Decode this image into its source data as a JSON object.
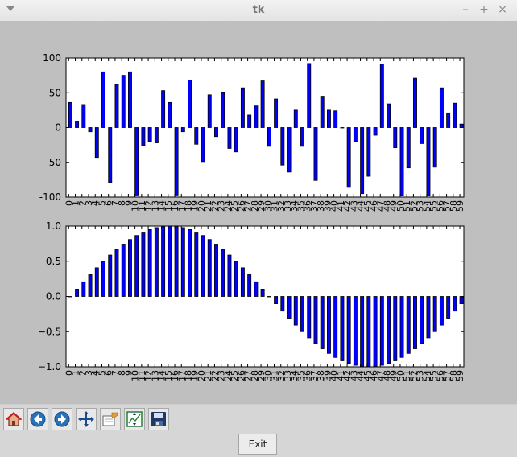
{
  "window": {
    "title": "tk"
  },
  "window_controls": {
    "minimize": "–",
    "maximize": "+",
    "close": "×"
  },
  "toolbar": {
    "tools": [
      {
        "name": "home",
        "icon": "home-icon"
      },
      {
        "name": "back",
        "icon": "back-arrow-icon"
      },
      {
        "name": "forward",
        "icon": "forward-arrow-icon"
      },
      {
        "name": "pan",
        "icon": "pan-move-icon"
      },
      {
        "name": "zoom",
        "icon": "zoom-rect-icon"
      },
      {
        "name": "configure",
        "icon": "subplots-config-icon"
      },
      {
        "name": "save",
        "icon": "save-disk-icon"
      }
    ],
    "exit_label": "Exit"
  },
  "chart_data": [
    {
      "type": "bar",
      "categories": [
        "0",
        "1",
        "2",
        "3",
        "4",
        "5",
        "6",
        "7",
        "8",
        "9",
        "10",
        "11",
        "12",
        "13",
        "14",
        "15",
        "16",
        "17",
        "18",
        "19",
        "20",
        "21",
        "22",
        "23",
        "24",
        "25",
        "26",
        "27",
        "28",
        "29",
        "30",
        "31",
        "32",
        "33",
        "34",
        "35",
        "36",
        "37",
        "38",
        "39",
        "40",
        "41",
        "42",
        "43",
        "44",
        "45",
        "46",
        "47",
        "48",
        "49",
        "50",
        "51",
        "52",
        "53",
        "54",
        "55",
        "56",
        "57",
        "58",
        "59"
      ],
      "values": [
        36,
        9,
        33,
        -6,
        -43,
        80,
        -79,
        62,
        75,
        80,
        -97,
        -26,
        -20,
        -22,
        53,
        36,
        -97,
        -6,
        68,
        -24,
        -49,
        47,
        -13,
        51,
        -30,
        -35,
        57,
        18,
        31,
        67,
        -27,
        41,
        -54,
        -64,
        25,
        -27,
        92,
        -76,
        45,
        25,
        24,
        0,
        -86,
        -20,
        -95,
        -70,
        -11,
        91,
        34,
        -29,
        -98,
        -58,
        71,
        -23,
        -98,
        -57,
        57,
        21,
        35,
        5
      ],
      "ylim": [
        -100,
        100
      ],
      "yticks": [
        -100,
        -50,
        0,
        50,
        100
      ],
      "bar_color": "#0000ff",
      "edge_color": "#000000"
    },
    {
      "type": "bar",
      "categories": [
        "0",
        "1",
        "2",
        "3",
        "4",
        "5",
        "6",
        "7",
        "8",
        "9",
        "10",
        "11",
        "12",
        "13",
        "14",
        "15",
        "16",
        "17",
        "18",
        "19",
        "20",
        "21",
        "22",
        "23",
        "24",
        "25",
        "26",
        "27",
        "28",
        "29",
        "30",
        "31",
        "32",
        "33",
        "34",
        "35",
        "36",
        "37",
        "38",
        "39",
        "40",
        "41",
        "42",
        "43",
        "44",
        "45",
        "46",
        "47",
        "48",
        "49",
        "50",
        "51",
        "52",
        "53",
        "54",
        "55",
        "56",
        "57",
        "58",
        "59"
      ],
      "values": [
        0.0,
        0.104,
        0.208,
        0.309,
        0.407,
        0.5,
        0.588,
        0.669,
        0.743,
        0.809,
        0.866,
        0.914,
        0.951,
        0.978,
        0.995,
        1.0,
        0.995,
        0.978,
        0.951,
        0.914,
        0.866,
        0.809,
        0.743,
        0.669,
        0.588,
        0.5,
        0.407,
        0.309,
        0.208,
        0.104,
        0.0,
        -0.104,
        -0.208,
        -0.309,
        -0.407,
        -0.5,
        -0.588,
        -0.669,
        -0.743,
        -0.809,
        -0.866,
        -0.914,
        -0.951,
        -0.978,
        -0.995,
        -1.0,
        -0.995,
        -0.978,
        -0.951,
        -0.914,
        -0.866,
        -0.809,
        -0.743,
        -0.669,
        -0.588,
        -0.5,
        -0.407,
        -0.309,
        -0.208,
        -0.104
      ],
      "ylim": [
        -1.0,
        1.0
      ],
      "yticks": [
        -1.0,
        -0.5,
        0.0,
        0.5,
        1.0
      ],
      "ytick_labels": [
        "−1.0",
        "−0.5",
        "0.0",
        "0.5",
        "1.0"
      ],
      "bar_color": "#0000ff",
      "edge_color": "#000000"
    }
  ]
}
